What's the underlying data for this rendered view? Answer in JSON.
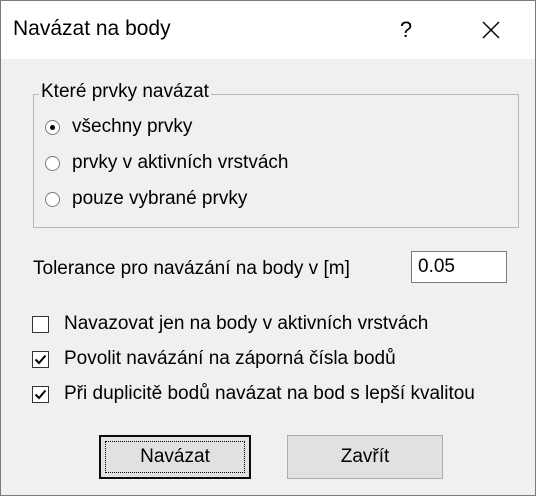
{
  "window": {
    "title": "Navázat na body",
    "help_label": "?",
    "close_icon": "close-icon"
  },
  "group": {
    "legend": "Které prvky navázat",
    "options": [
      {
        "label": "všechny prvky",
        "checked": true
      },
      {
        "label": "prvky v aktivních vrstvách",
        "checked": false
      },
      {
        "label": "pouze vybrané prvky",
        "checked": false
      }
    ]
  },
  "tolerance": {
    "label": "Tolerance pro navázání na body v [m]",
    "value": "0.05"
  },
  "checkboxes": [
    {
      "label": "Navazovat jen na body v aktivních vrstvách",
      "checked": false
    },
    {
      "label": "Povolit navázání na záporná čísla bodů",
      "checked": true
    },
    {
      "label": "Při duplicitě bodů navázat na bod s lepší kvalitou",
      "checked": true
    }
  ],
  "buttons": {
    "ok_label": "Navázat",
    "close_label": "Zavřít"
  }
}
